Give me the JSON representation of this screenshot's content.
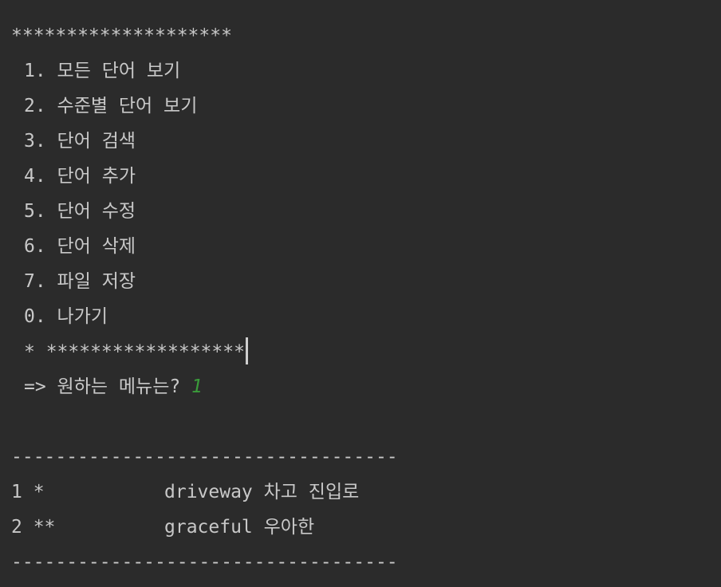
{
  "console": {
    "top_border": "********************",
    "menu_items": [
      "1. 모든 단어 보기",
      "2. 수준별 단어 보기",
      "3. 단어 검색",
      "4. 단어 추가",
      "5. 단어 수정",
      "6. 단어 삭제",
      "7. 파일 저장",
      "0. 나가기"
    ],
    "bottom_border": "* ******************",
    "prompt": "=> 원하는 메뉴는? ",
    "input_value": "1",
    "input_color": "#3a9b3a",
    "separator": "-----------------------------------",
    "words": [
      {
        "level": "1 *",
        "word": "driveway",
        "meaning": "차고 진입로"
      },
      {
        "level": "2 **",
        "word": "graceful",
        "meaning": "우아한"
      }
    ]
  }
}
